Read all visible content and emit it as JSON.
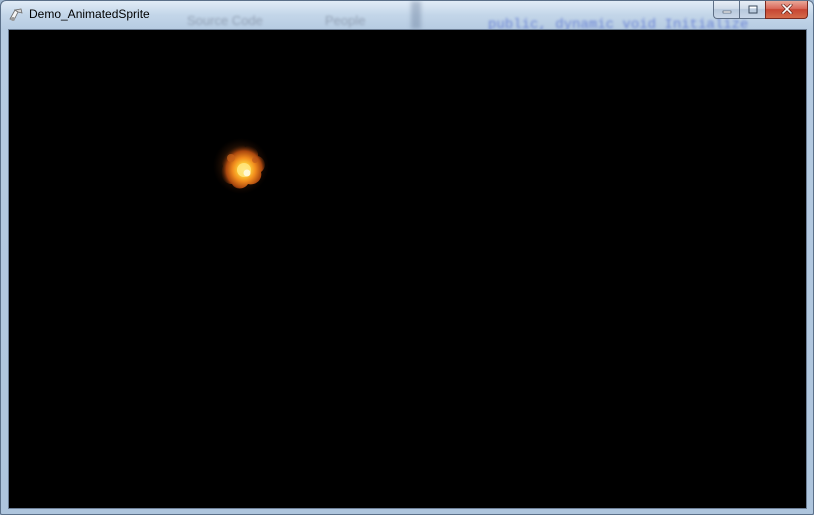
{
  "window": {
    "title": "Demo_AnimatedSprite",
    "icon": "app-icon",
    "caption_buttons": [
      "minimize-icon",
      "maximize-icon",
      "close-icon"
    ]
  },
  "background_bleed": {
    "texts": [
      "Source Code",
      "People",
      "public, dynamic void Initialize"
    ]
  },
  "canvas": {
    "background": "#000000",
    "sprite": "explosion-sprite"
  },
  "colors": {
    "close_button": "#c64532",
    "canvas": "#000000"
  }
}
